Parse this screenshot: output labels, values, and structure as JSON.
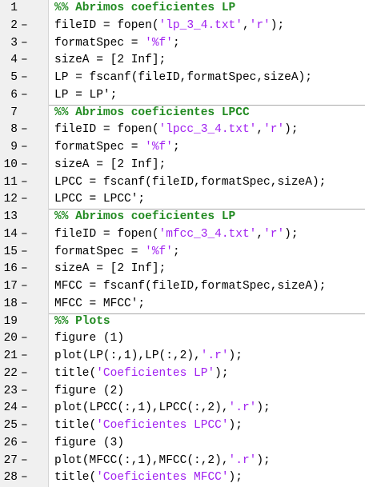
{
  "editor": {
    "lines": [
      {
        "n": "1",
        "mark": "",
        "segs": [
          {
            "t": "%% Abrimos coeficientes LP",
            "c": "cmt"
          }
        ]
      },
      {
        "n": "2",
        "mark": "–",
        "segs": [
          {
            "t": "fileID = fopen(",
            "c": ""
          },
          {
            "t": "'lp_3_4.txt'",
            "c": "str"
          },
          {
            "t": ",",
            "c": ""
          },
          {
            "t": "'r'",
            "c": "str"
          },
          {
            "t": ");",
            "c": ""
          }
        ]
      },
      {
        "n": "3",
        "mark": "–",
        "segs": [
          {
            "t": "formatSpec = ",
            "c": ""
          },
          {
            "t": "'%f'",
            "c": "str"
          },
          {
            "t": ";",
            "c": ""
          }
        ]
      },
      {
        "n": "4",
        "mark": "–",
        "segs": [
          {
            "t": "sizeA = [2 Inf];",
            "c": ""
          }
        ]
      },
      {
        "n": "5",
        "mark": "–",
        "segs": [
          {
            "t": "LP = fscanf(fileID,formatSpec,sizeA);",
            "c": ""
          }
        ]
      },
      {
        "n": "6",
        "mark": "–",
        "segs": [
          {
            "t": "LP = LP';",
            "c": ""
          }
        ]
      },
      {
        "n": "7",
        "mark": "",
        "segs": [
          {
            "t": "%% Abrimos coeficientes LPCC",
            "c": "cmt"
          }
        ]
      },
      {
        "n": "8",
        "mark": "–",
        "segs": [
          {
            "t": "fileID = fopen(",
            "c": ""
          },
          {
            "t": "'lpcc_3_4.txt'",
            "c": "str"
          },
          {
            "t": ",",
            "c": ""
          },
          {
            "t": "'r'",
            "c": "str"
          },
          {
            "t": ");",
            "c": ""
          }
        ]
      },
      {
        "n": "9",
        "mark": "–",
        "segs": [
          {
            "t": "formatSpec = ",
            "c": ""
          },
          {
            "t": "'%f'",
            "c": "str"
          },
          {
            "t": ";",
            "c": ""
          }
        ]
      },
      {
        "n": "10",
        "mark": "–",
        "segs": [
          {
            "t": "sizeA = [2 Inf];",
            "c": ""
          }
        ]
      },
      {
        "n": "11",
        "mark": "–",
        "segs": [
          {
            "t": "LPCC = fscanf(fileID,formatSpec,sizeA);",
            "c": ""
          }
        ]
      },
      {
        "n": "12",
        "mark": "–",
        "segs": [
          {
            "t": "LPCC = LPCC';",
            "c": ""
          }
        ]
      },
      {
        "n": "13",
        "mark": "",
        "segs": [
          {
            "t": "%% Abrimos coeficientes LP",
            "c": "cmt"
          }
        ]
      },
      {
        "n": "14",
        "mark": "–",
        "segs": [
          {
            "t": "fileID = fopen(",
            "c": ""
          },
          {
            "t": "'mfcc_3_4.txt'",
            "c": "str"
          },
          {
            "t": ",",
            "c": ""
          },
          {
            "t": "'r'",
            "c": "str"
          },
          {
            "t": ");",
            "c": ""
          }
        ]
      },
      {
        "n": "15",
        "mark": "–",
        "segs": [
          {
            "t": "formatSpec = ",
            "c": ""
          },
          {
            "t": "'%f'",
            "c": "str"
          },
          {
            "t": ";",
            "c": ""
          }
        ]
      },
      {
        "n": "16",
        "mark": "–",
        "segs": [
          {
            "t": "sizeA = [2 Inf];",
            "c": ""
          }
        ]
      },
      {
        "n": "17",
        "mark": "–",
        "segs": [
          {
            "t": "MFCC = fscanf(fileID,formatSpec,sizeA);",
            "c": ""
          }
        ]
      },
      {
        "n": "18",
        "mark": "–",
        "segs": [
          {
            "t": "MFCC = MFCC';",
            "c": ""
          }
        ]
      },
      {
        "n": "19",
        "mark": "",
        "segs": [
          {
            "t": "%% Plots",
            "c": "cmt"
          }
        ]
      },
      {
        "n": "20",
        "mark": "–",
        "segs": [
          {
            "t": "figure (1)",
            "c": ""
          }
        ]
      },
      {
        "n": "21",
        "mark": "–",
        "segs": [
          {
            "t": "plot(LP(:,1),LP(:,2),",
            "c": ""
          },
          {
            "t": "'.r'",
            "c": "str"
          },
          {
            "t": ");",
            "c": ""
          }
        ]
      },
      {
        "n": "22",
        "mark": "–",
        "segs": [
          {
            "t": "title(",
            "c": ""
          },
          {
            "t": "'Coeficientes LP'",
            "c": "str"
          },
          {
            "t": ");",
            "c": ""
          }
        ]
      },
      {
        "n": "23",
        "mark": "–",
        "segs": [
          {
            "t": "figure (2)",
            "c": ""
          }
        ]
      },
      {
        "n": "24",
        "mark": "–",
        "segs": [
          {
            "t": "plot(LPCC(:,1),LPCC(:,2),",
            "c": ""
          },
          {
            "t": "'.r'",
            "c": "str"
          },
          {
            "t": ");",
            "c": ""
          }
        ]
      },
      {
        "n": "25",
        "mark": "–",
        "segs": [
          {
            "t": "title(",
            "c": ""
          },
          {
            "t": "'Coeficientes LPCC'",
            "c": "str"
          },
          {
            "t": ");",
            "c": ""
          }
        ]
      },
      {
        "n": "26",
        "mark": "–",
        "segs": [
          {
            "t": "figure (3)",
            "c": ""
          }
        ]
      },
      {
        "n": "27",
        "mark": "–",
        "segs": [
          {
            "t": "plot(MFCC(:,1),MFCC(:,2),",
            "c": ""
          },
          {
            "t": "'.r'",
            "c": "str"
          },
          {
            "t": ");",
            "c": ""
          }
        ]
      },
      {
        "n": "28",
        "mark": "–",
        "segs": [
          {
            "t": "title(",
            "c": ""
          },
          {
            "t": "'Coeficientes MFCC'",
            "c": "str"
          },
          {
            "t": ");",
            "c": ""
          }
        ]
      }
    ]
  }
}
